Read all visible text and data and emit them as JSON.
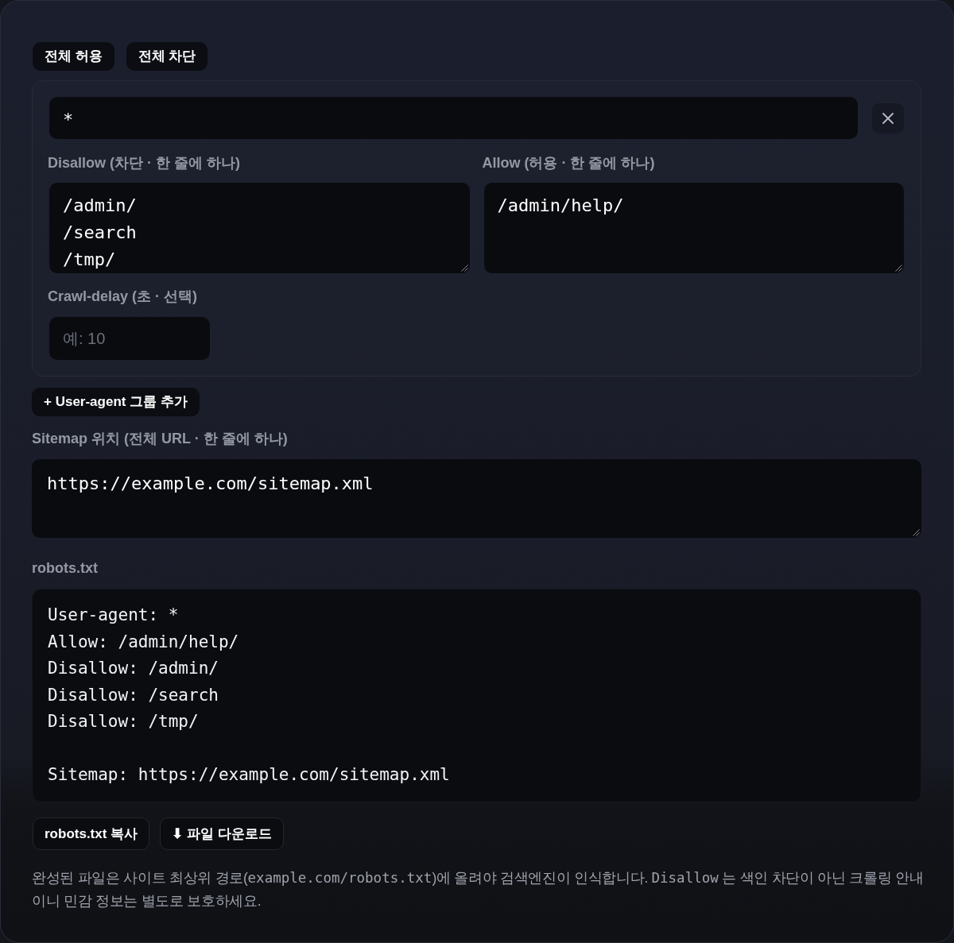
{
  "preset_buttons": [
    {
      "label": "전체 허용"
    },
    {
      "label": "전체 차단"
    }
  ],
  "groups": [
    {
      "user_agent": {
        "value": "*"
      },
      "disallow": {
        "label": "Disallow (차단 · 한 줄에 하나)",
        "lines": [
          "/admin/",
          "/search",
          "/tmp/"
        ]
      },
      "allow": {
        "label": "Allow (허용 · 한 줄에 하나)",
        "lines": [
          "/admin/help/"
        ]
      },
      "crawl_delay": {
        "label": "Crawl-delay (초 · 선택)",
        "placeholder": "예: 10"
      }
    }
  ],
  "add_group_button": {
    "label": "+ User-agent 그룹 추가"
  },
  "sitemap": {
    "label": "Sitemap 위치 (전체 URL · 한 줄에 하나)",
    "lines": [
      "https://example.com/sitemap.xml"
    ]
  },
  "output": {
    "label": "robots.txt",
    "blocks": [
      [
        "User-agent: *",
        "Allow: /admin/help/",
        "Disallow: /admin/",
        "Disallow: /search",
        "Disallow: /tmp/"
      ],
      [
        "Sitemap: https://example.com/sitemap.xml"
      ]
    ]
  },
  "actions": [
    {
      "label": "robots.txt 복사"
    },
    {
      "label": "⬇ 파일 다운로드"
    }
  ],
  "note": [
    {
      "text": "완성된 파일은 사이트 최상위 경로(",
      "code": false
    },
    {
      "text": "example.com/robots.txt",
      "code": true
    },
    {
      "text": ")에 올려야 검색엔진이 인식합니다. ",
      "code": false
    },
    {
      "text": "Disallow",
      "code": true
    },
    {
      "text": " 는 색인 차단이 아닌 크롤링 안내이니 민감 정보는 별도로 보호하세요.",
      "code": false
    }
  ]
}
